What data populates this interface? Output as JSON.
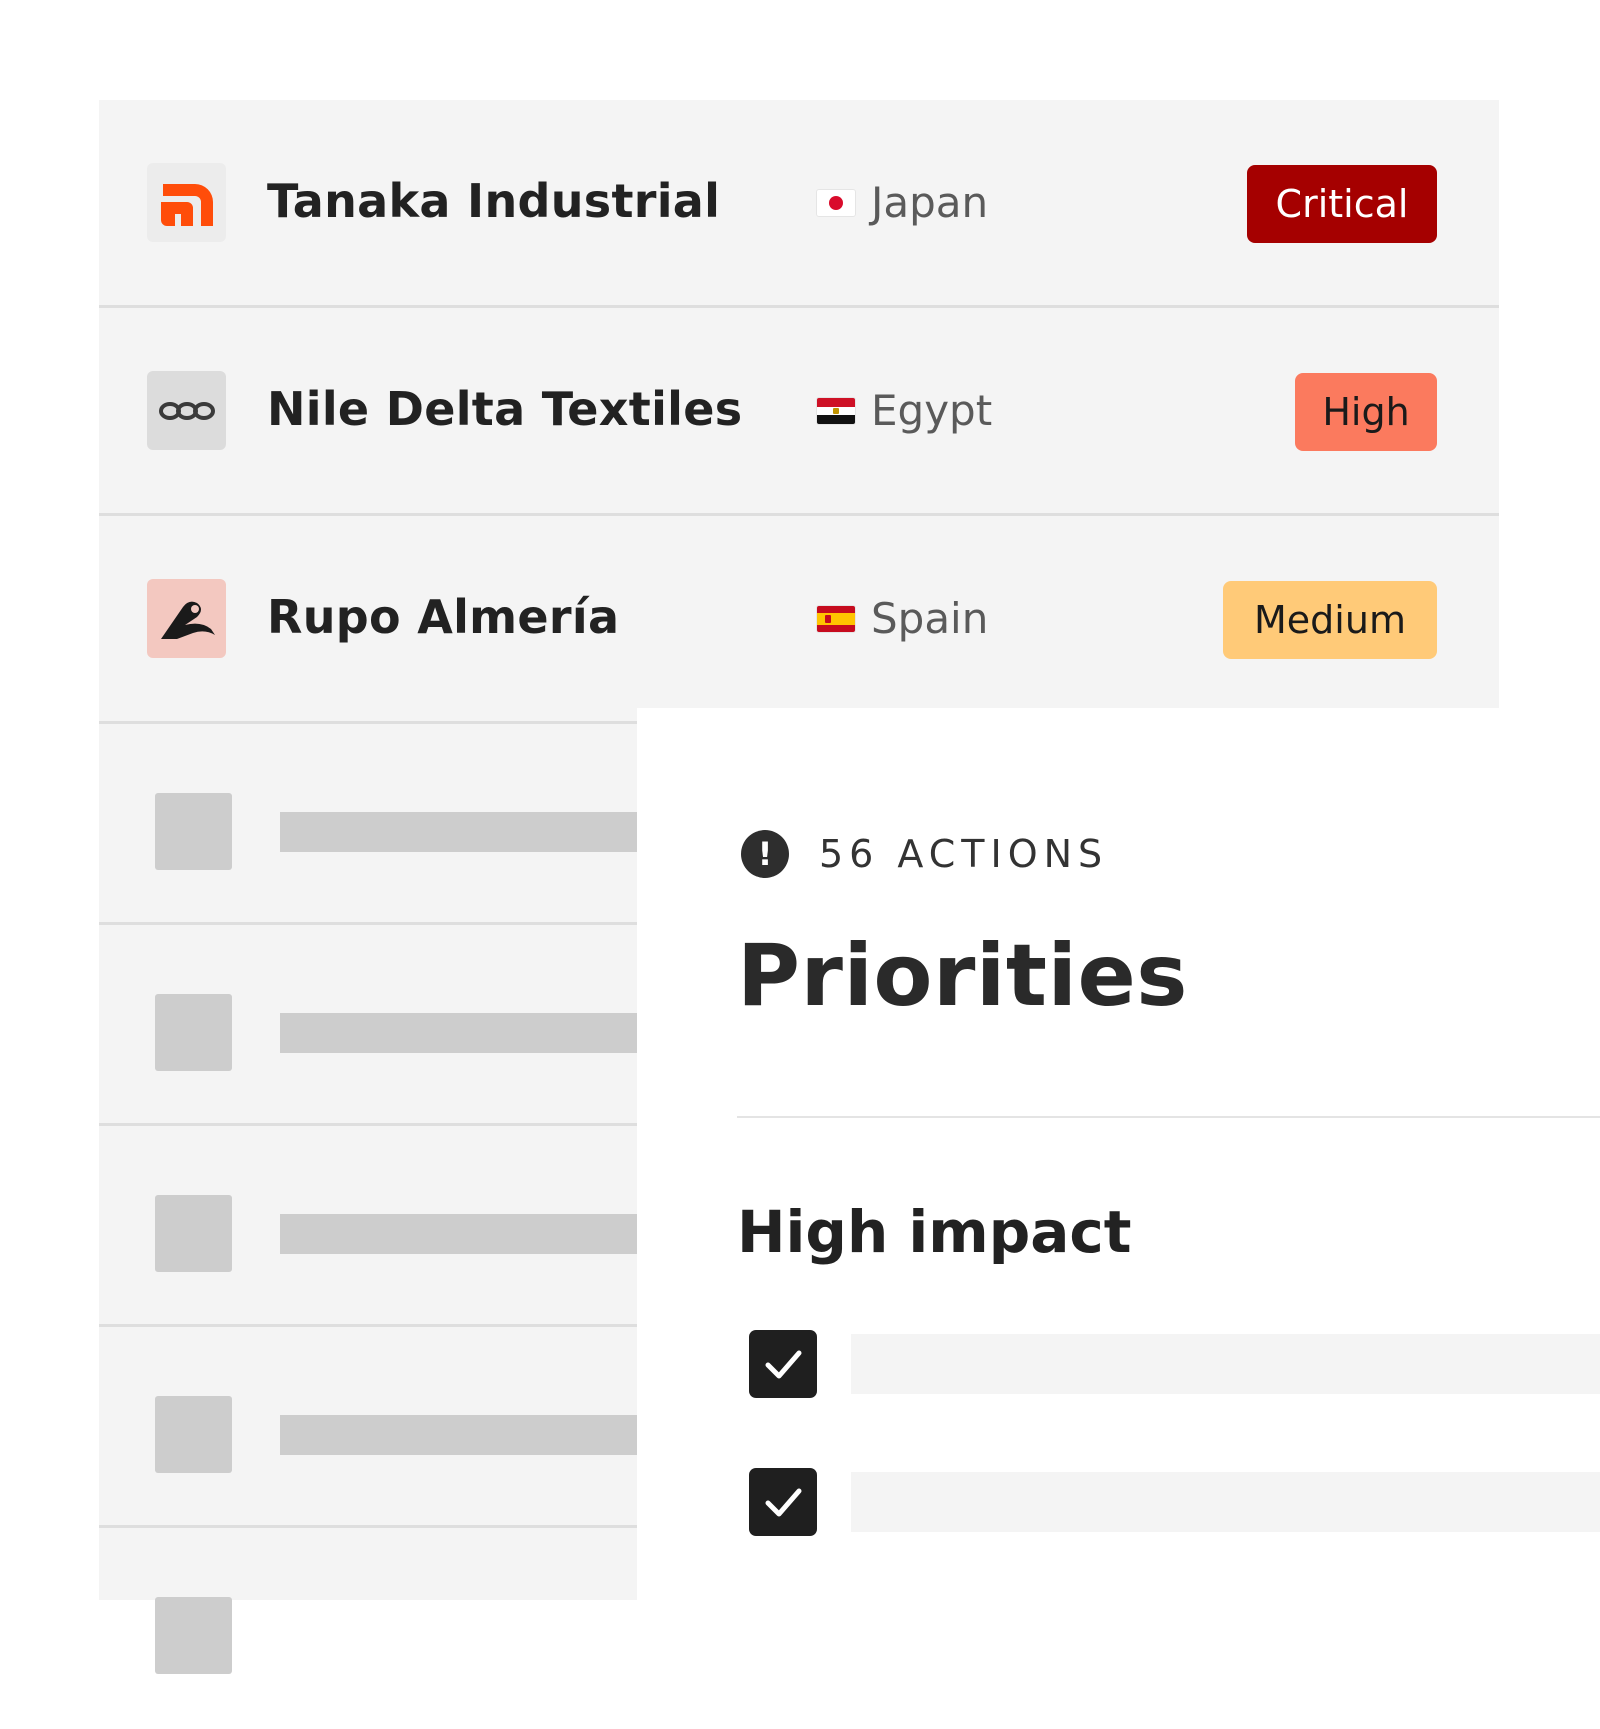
{
  "suppliers": [
    {
      "name": "Tanaka Industrial",
      "country": "Japan",
      "flag_icon": "japan-flag-icon",
      "priority": "Critical",
      "badge_bg": "#a50000",
      "badge_fg": "#ffffff",
      "logo_icon": "tanaka-logo-icon",
      "logo_bg": "#ececec",
      "logo_color": "#ff4d0a"
    },
    {
      "name": "Nile Delta Textiles",
      "country": "Egypt",
      "flag_icon": "egypt-flag-icon",
      "priority": "High",
      "badge_bg": "#fb7a5e",
      "badge_fg": "#1a1a1a",
      "logo_icon": "nile-delta-logo-icon",
      "logo_bg": "#dcdcdc",
      "logo_color": "#3a3a3a"
    },
    {
      "name": "Rupo Almería",
      "country": "Spain",
      "flag_icon": "spain-flag-icon",
      "priority": "Medium",
      "badge_bg": "#ffca78",
      "badge_fg": "#1a1a1a",
      "logo_icon": "rupo-logo-icon",
      "logo_bg": "#f3c8c0",
      "logo_color": "#1a1a1a"
    }
  ],
  "panel": {
    "count_label": "56 ACTIONS",
    "alert_icon": "alert-circle-icon",
    "title": "Priorities",
    "section_title": "High impact",
    "tasks": [
      {
        "checked": true,
        "check_icon": "checkmark-icon"
      },
      {
        "checked": true,
        "check_icon": "checkmark-icon"
      }
    ]
  },
  "colors": {
    "list_bg": "#f4f4f4",
    "skeleton": "#cdcdcd",
    "checkbox": "#1f1f1f"
  }
}
